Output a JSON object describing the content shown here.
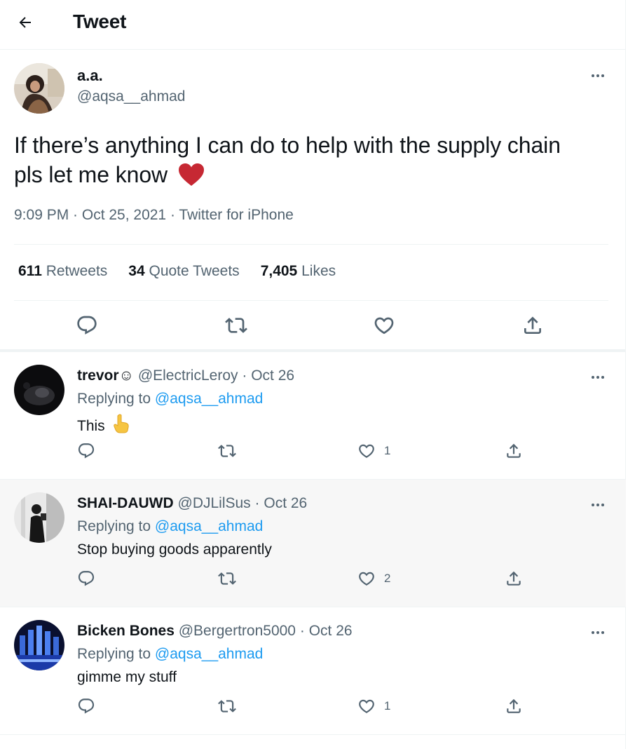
{
  "header": {
    "title": "Tweet"
  },
  "main_tweet": {
    "name": "a.a.",
    "handle": "@aqsa__ahmad",
    "text": "If there’s anything I can do to help with the supply chain pls let me know",
    "meta": "9:09 PM · Oct 25, 2021 · Twitter for iPhone",
    "stats": {
      "retweets_count": "611",
      "retweets_label": "Retweets",
      "quotes_count": "34",
      "quotes_label": "Quote Tweets",
      "likes_count": "7,405",
      "likes_label": "Likes"
    }
  },
  "replies": [
    {
      "name": "trevor☺",
      "handle": "@ElectricLeroy",
      "date": "Oct 26",
      "replying_prefix": "Replying to",
      "replying_to": "@aqsa__ahmad",
      "text": "This",
      "likes": "1"
    },
    {
      "name": "SHAI-DAUWD",
      "handle": "@DJLilSus",
      "date": "Oct 26",
      "replying_prefix": "Replying to",
      "replying_to": "@aqsa__ahmad",
      "text": "Stop buying goods apparently",
      "likes": "2"
    },
    {
      "name": "Bicken Bones",
      "handle": "@Bergertron5000",
      "date": "Oct 26",
      "replying_prefix": "Replying to",
      "replying_to": "@aqsa__ahmad",
      "text": "gimme my stuff",
      "likes": "1"
    }
  ],
  "icons": {
    "back": "arrow-left-icon",
    "more": "more-dots-icon",
    "reply": "reply-bubble-icon",
    "retweet": "retweet-icon",
    "like": "heart-outline-icon",
    "share": "share-icon",
    "emoji_heart": "red-heart-emoji",
    "emoji_point": "pointing-up-emoji"
  },
  "colors": {
    "accent": "#1d9bf0",
    "text": "#0f1419",
    "secondary": "#536471",
    "border": "#eff3f4",
    "heart": "#d32f3f"
  }
}
